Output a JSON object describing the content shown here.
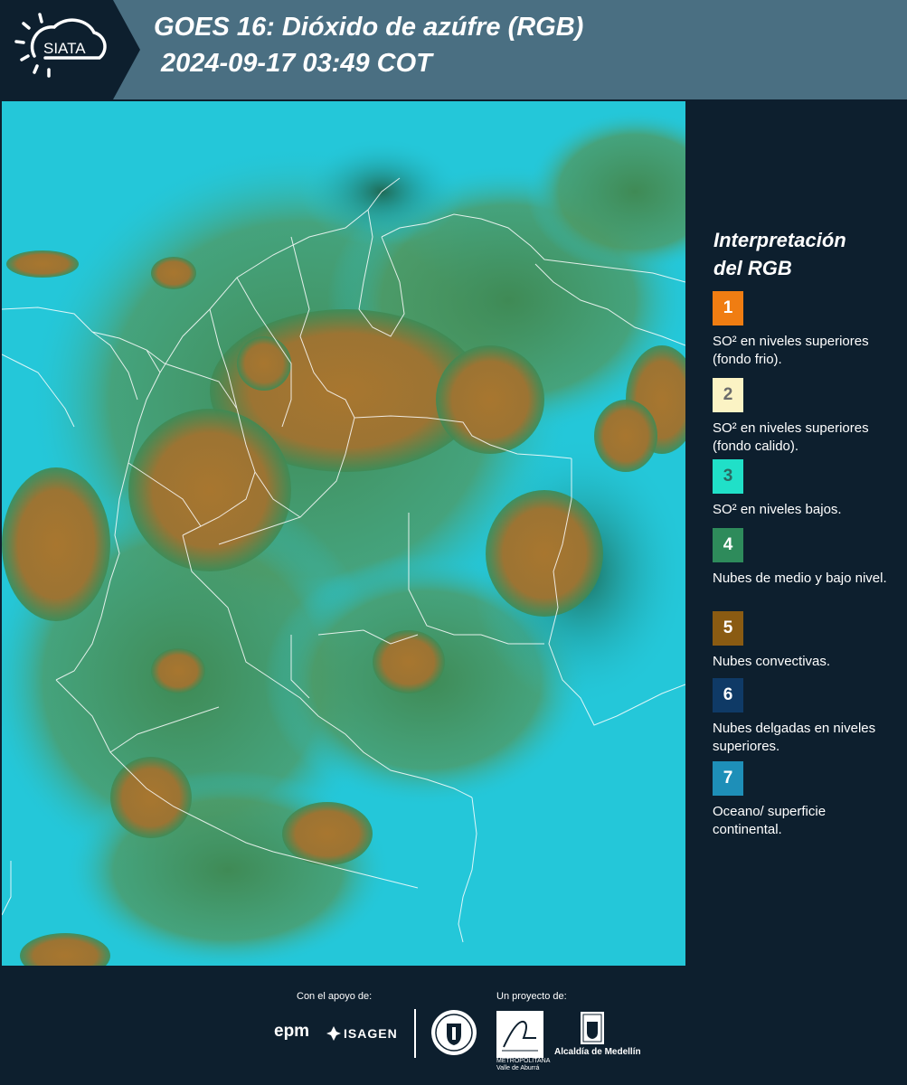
{
  "header": {
    "logo_text": "SIATA",
    "title_line1": "GOES 16: Dióxido de azúfre (RGB)",
    "title_line2": "2024-09-17 03:49 COT",
    "background": "#4a6f82",
    "logo_background": "#0d1f2e"
  },
  "map": {
    "icon": "satellite-image",
    "ocean_color": "#24c7d9",
    "convective_color": "#a8762f",
    "mid_cloud_color": "#3f8a55",
    "border_color": "#ffffff"
  },
  "legend": {
    "title_line1": "Interpretación",
    "title_line2": "del RGB",
    "items": [
      {
        "number": "1",
        "label": "SO² en niveles superiores (fondo frio).",
        "color": "#f07d12"
      },
      {
        "number": "2",
        "label": "SO² en niveles superiores (fondo calido).",
        "color": "#fbf3c4"
      },
      {
        "number": "3",
        "label": "SO² en niveles bajos.",
        "color": "#20e0c8"
      },
      {
        "number": "4",
        "label": "Nubes de medio y bajo nivel.",
        "color": "#2e8b5b"
      },
      {
        "number": "5",
        "label": "Nubes convectivas.",
        "color": "#8a5b12"
      },
      {
        "number": "6",
        "label": "Nubes delgadas en niveles superiores.",
        "color": "#0f3a66"
      },
      {
        "number": "7",
        "label": "Oceano/ superficie continental.",
        "color": "#1e8fb8"
      }
    ]
  },
  "footer": {
    "support_label": "Con el apoyo de:",
    "project_label": "Un proyecto de:",
    "sponsors": [
      "epm",
      "ISAGEN"
    ],
    "area_text": "METROPOLITANA Valle de Aburrá",
    "alcaldia": "Alcaldía de Medellín"
  }
}
